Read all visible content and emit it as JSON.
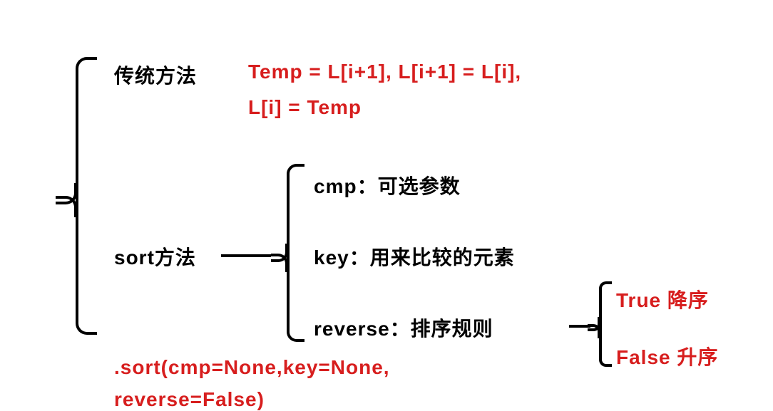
{
  "root": {
    "branch1": {
      "label": "传统方法",
      "code_line1": "Temp = L[i+1], L[i+1] = L[i],",
      "code_line2": "L[i] = Temp"
    },
    "branch2": {
      "label": "sort方法",
      "params": {
        "cmp": "cmp：可选参数",
        "key": "key：用来比较的元素",
        "reverse": {
          "label": "reverse：排序规则",
          "true": "True 降序",
          "false": "False 升序"
        }
      },
      "call_line1": ".sort(cmp=None,key=None,",
      "call_line2": "reverse=False)"
    }
  }
}
